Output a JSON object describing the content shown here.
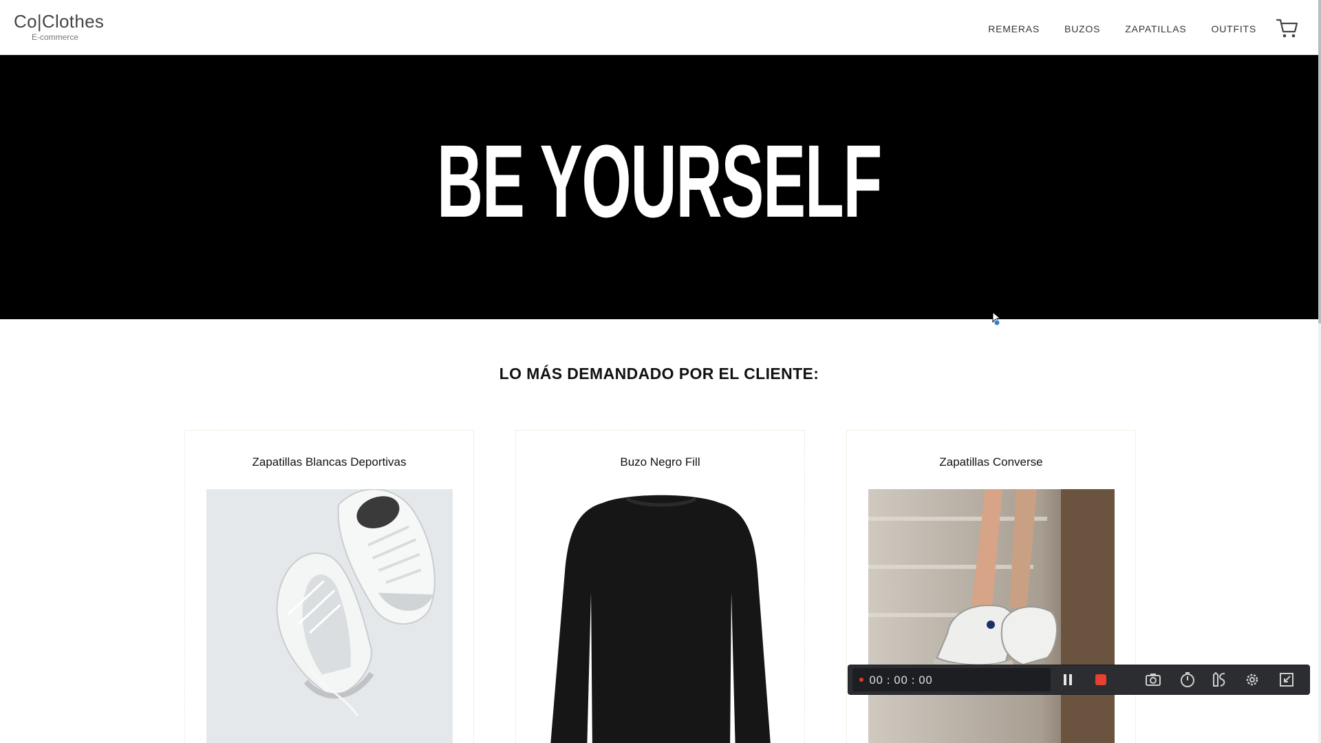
{
  "header": {
    "logo_main": "Co|Clothes",
    "logo_sub": "E-commerce",
    "nav": [
      "REMERAS",
      "BUZOS",
      "ZAPATILLAS",
      "OUTFITS"
    ],
    "cart_icon": "cart-icon"
  },
  "hero": {
    "title": "BE YOURSELF",
    "background": "#000000"
  },
  "section": {
    "title": "LO MÁS DEMANDADO POR EL CLIENTE:"
  },
  "products": [
    {
      "name": "Zapatillas Blancas Deportivas"
    },
    {
      "name": "Buzo Negro Fill"
    },
    {
      "name": "Zapatillas Converse"
    }
  ],
  "recorder": {
    "time": "00 : 00 : 00",
    "icons": [
      "pause-icon",
      "stop-icon",
      "camera-icon",
      "timer-icon",
      "draw-icon",
      "settings-icon",
      "minimize-icon"
    ],
    "stop_color": "#e8402f"
  }
}
